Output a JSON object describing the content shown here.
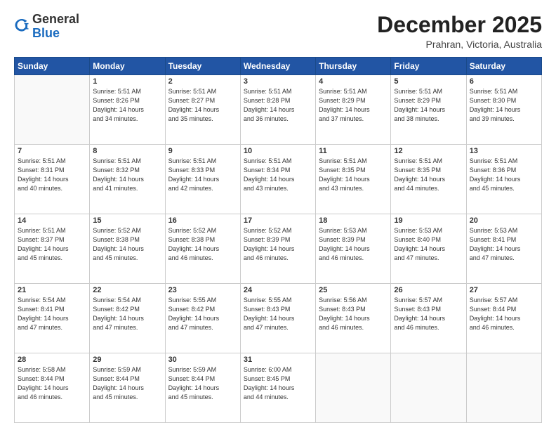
{
  "logo": {
    "general": "General",
    "blue": "Blue"
  },
  "header": {
    "month": "December 2025",
    "location": "Prahran, Victoria, Australia"
  },
  "days_of_week": [
    "Sunday",
    "Monday",
    "Tuesday",
    "Wednesday",
    "Thursday",
    "Friday",
    "Saturday"
  ],
  "weeks": [
    [
      {
        "day": "",
        "info": ""
      },
      {
        "day": "1",
        "info": "Sunrise: 5:51 AM\nSunset: 8:26 PM\nDaylight: 14 hours\nand 34 minutes."
      },
      {
        "day": "2",
        "info": "Sunrise: 5:51 AM\nSunset: 8:27 PM\nDaylight: 14 hours\nand 35 minutes."
      },
      {
        "day": "3",
        "info": "Sunrise: 5:51 AM\nSunset: 8:28 PM\nDaylight: 14 hours\nand 36 minutes."
      },
      {
        "day": "4",
        "info": "Sunrise: 5:51 AM\nSunset: 8:29 PM\nDaylight: 14 hours\nand 37 minutes."
      },
      {
        "day": "5",
        "info": "Sunrise: 5:51 AM\nSunset: 8:29 PM\nDaylight: 14 hours\nand 38 minutes."
      },
      {
        "day": "6",
        "info": "Sunrise: 5:51 AM\nSunset: 8:30 PM\nDaylight: 14 hours\nand 39 minutes."
      }
    ],
    [
      {
        "day": "7",
        "info": "Sunrise: 5:51 AM\nSunset: 8:31 PM\nDaylight: 14 hours\nand 40 minutes."
      },
      {
        "day": "8",
        "info": "Sunrise: 5:51 AM\nSunset: 8:32 PM\nDaylight: 14 hours\nand 41 minutes."
      },
      {
        "day": "9",
        "info": "Sunrise: 5:51 AM\nSunset: 8:33 PM\nDaylight: 14 hours\nand 42 minutes."
      },
      {
        "day": "10",
        "info": "Sunrise: 5:51 AM\nSunset: 8:34 PM\nDaylight: 14 hours\nand 43 minutes."
      },
      {
        "day": "11",
        "info": "Sunrise: 5:51 AM\nSunset: 8:35 PM\nDaylight: 14 hours\nand 43 minutes."
      },
      {
        "day": "12",
        "info": "Sunrise: 5:51 AM\nSunset: 8:35 PM\nDaylight: 14 hours\nand 44 minutes."
      },
      {
        "day": "13",
        "info": "Sunrise: 5:51 AM\nSunset: 8:36 PM\nDaylight: 14 hours\nand 45 minutes."
      }
    ],
    [
      {
        "day": "14",
        "info": "Sunrise: 5:51 AM\nSunset: 8:37 PM\nDaylight: 14 hours\nand 45 minutes."
      },
      {
        "day": "15",
        "info": "Sunrise: 5:52 AM\nSunset: 8:38 PM\nDaylight: 14 hours\nand 45 minutes."
      },
      {
        "day": "16",
        "info": "Sunrise: 5:52 AM\nSunset: 8:38 PM\nDaylight: 14 hours\nand 46 minutes."
      },
      {
        "day": "17",
        "info": "Sunrise: 5:52 AM\nSunset: 8:39 PM\nDaylight: 14 hours\nand 46 minutes."
      },
      {
        "day": "18",
        "info": "Sunrise: 5:53 AM\nSunset: 8:39 PM\nDaylight: 14 hours\nand 46 minutes."
      },
      {
        "day": "19",
        "info": "Sunrise: 5:53 AM\nSunset: 8:40 PM\nDaylight: 14 hours\nand 47 minutes."
      },
      {
        "day": "20",
        "info": "Sunrise: 5:53 AM\nSunset: 8:41 PM\nDaylight: 14 hours\nand 47 minutes."
      }
    ],
    [
      {
        "day": "21",
        "info": "Sunrise: 5:54 AM\nSunset: 8:41 PM\nDaylight: 14 hours\nand 47 minutes."
      },
      {
        "day": "22",
        "info": "Sunrise: 5:54 AM\nSunset: 8:42 PM\nDaylight: 14 hours\nand 47 minutes."
      },
      {
        "day": "23",
        "info": "Sunrise: 5:55 AM\nSunset: 8:42 PM\nDaylight: 14 hours\nand 47 minutes."
      },
      {
        "day": "24",
        "info": "Sunrise: 5:55 AM\nSunset: 8:43 PM\nDaylight: 14 hours\nand 47 minutes."
      },
      {
        "day": "25",
        "info": "Sunrise: 5:56 AM\nSunset: 8:43 PM\nDaylight: 14 hours\nand 46 minutes."
      },
      {
        "day": "26",
        "info": "Sunrise: 5:57 AM\nSunset: 8:43 PM\nDaylight: 14 hours\nand 46 minutes."
      },
      {
        "day": "27",
        "info": "Sunrise: 5:57 AM\nSunset: 8:44 PM\nDaylight: 14 hours\nand 46 minutes."
      }
    ],
    [
      {
        "day": "28",
        "info": "Sunrise: 5:58 AM\nSunset: 8:44 PM\nDaylight: 14 hours\nand 46 minutes."
      },
      {
        "day": "29",
        "info": "Sunrise: 5:59 AM\nSunset: 8:44 PM\nDaylight: 14 hours\nand 45 minutes."
      },
      {
        "day": "30",
        "info": "Sunrise: 5:59 AM\nSunset: 8:44 PM\nDaylight: 14 hours\nand 45 minutes."
      },
      {
        "day": "31",
        "info": "Sunrise: 6:00 AM\nSunset: 8:45 PM\nDaylight: 14 hours\nand 44 minutes."
      },
      {
        "day": "",
        "info": ""
      },
      {
        "day": "",
        "info": ""
      },
      {
        "day": "",
        "info": ""
      }
    ]
  ]
}
